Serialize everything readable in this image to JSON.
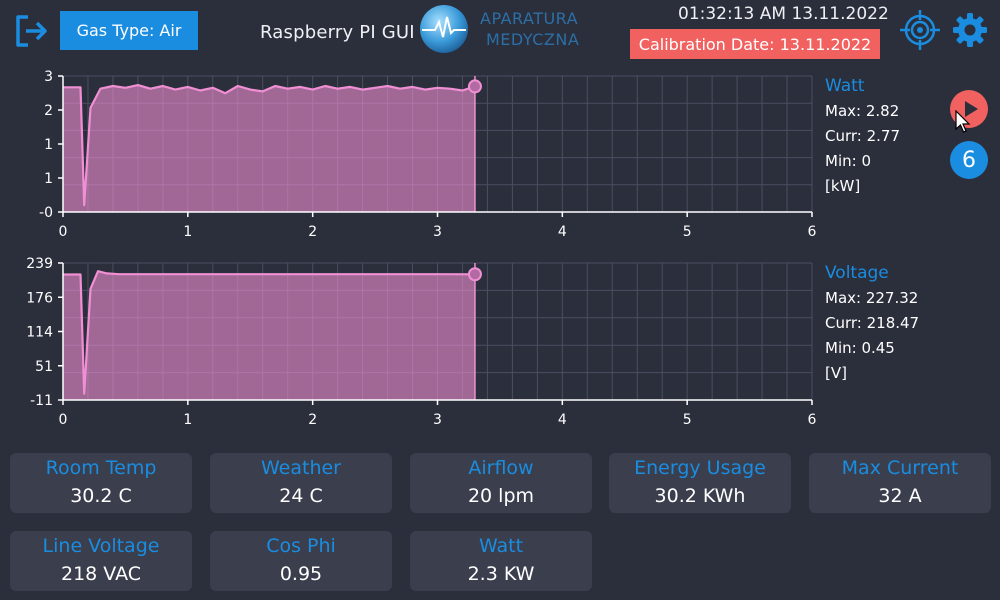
{
  "header": {
    "gas_type": "Gas Type: Air",
    "app_title": "Raspberry PI GUI",
    "brand_line1": "APARATURA",
    "brand_line2": "MEDYCZNA",
    "datetime": "01:32:13 AM 13.11.2022",
    "calibration": "Calibration Date: 13.11.2022",
    "icons": [
      "exit-icon",
      "crosshair-icon",
      "gear-icon"
    ]
  },
  "controls": {
    "badge_count": "6",
    "play_icon": "play-icon"
  },
  "charts": [
    {
      "title": "Watt",
      "max": "Max: 2.82",
      "curr": "Curr: 2.77",
      "min": "Min: 0",
      "unit": "[kW]"
    },
    {
      "title": "Voltage",
      "max": "Max: 227.32",
      "curr": "Curr: 218.47",
      "min": "Min: 0.45",
      "unit": "[V]"
    }
  ],
  "chart_data": [
    {
      "type": "area",
      "title": "Watt",
      "xlim": [
        0,
        6
      ],
      "x_ticks": [
        "0",
        "1",
        "2",
        "3",
        "4",
        "5",
        "6"
      ],
      "y_ticks": [
        "3",
        "2",
        "1",
        "1",
        "-0"
      ],
      "ylim": [
        0,
        3
      ],
      "x": [
        0,
        0.14,
        0.17,
        0.22,
        0.3,
        0.4,
        0.5,
        0.6,
        0.7,
        0.8,
        0.9,
        1.0,
        1.1,
        1.2,
        1.3,
        1.4,
        1.5,
        1.6,
        1.7,
        1.8,
        1.9,
        2.0,
        2.1,
        2.2,
        2.3,
        2.4,
        2.5,
        2.6,
        2.7,
        2.8,
        2.9,
        3.0,
        3.1,
        3.2,
        3.3
      ],
      "y": [
        2.75,
        2.75,
        0.15,
        2.3,
        2.72,
        2.78,
        2.74,
        2.8,
        2.72,
        2.78,
        2.7,
        2.76,
        2.68,
        2.74,
        2.62,
        2.78,
        2.7,
        2.66,
        2.78,
        2.72,
        2.76,
        2.7,
        2.78,
        2.72,
        2.76,
        2.7,
        2.74,
        2.78,
        2.72,
        2.76,
        2.7,
        2.74,
        2.72,
        2.68,
        2.77
      ],
      "grid": true,
      "color": "#f08fd3"
    },
    {
      "type": "area",
      "title": "Voltage",
      "xlim": [
        0,
        6
      ],
      "x_ticks": [
        "0",
        "1",
        "2",
        "3",
        "4",
        "5",
        "6"
      ],
      "y_ticks": [
        "239",
        "176",
        "114",
        "51",
        "-11"
      ],
      "ylim": [
        -11,
        239
      ],
      "x": [
        0,
        0.14,
        0.17,
        0.22,
        0.28,
        0.35,
        0.45,
        1.0,
        2.0,
        3.0,
        3.3
      ],
      "y": [
        218,
        218,
        0.45,
        192,
        224,
        220,
        218.5,
        218.5,
        218.5,
        218.5,
        218.47
      ],
      "grid": true,
      "color": "#f08fd3"
    }
  ],
  "cards": [
    {
      "title": "Room Temp",
      "value": "30.2 C"
    },
    {
      "title": "Weather",
      "value": "24 C"
    },
    {
      "title": "Airflow",
      "value": "20 lpm"
    },
    {
      "title": "Energy Usage",
      "value": "30.2 KWh"
    },
    {
      "title": "Max Current",
      "value": "32 A"
    },
    {
      "title": "Line Voltage",
      "value": "218 VAC"
    },
    {
      "title": "Cos Phi",
      "value": "0.95"
    },
    {
      "title": "Watt",
      "value": "2.3 KW"
    }
  ],
  "colors": {
    "background": "#2b2e3b",
    "accent": "#1a8de0",
    "alert": "#f0615f",
    "series": "#f08fd3",
    "card": "#3a3e4d"
  }
}
